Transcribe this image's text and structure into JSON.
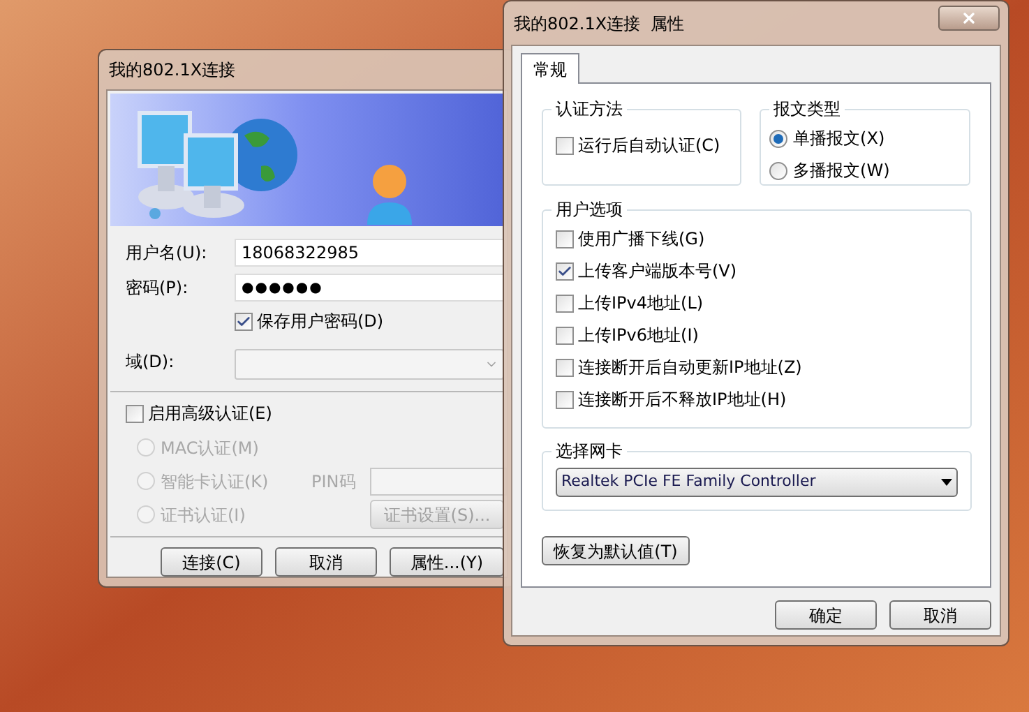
{
  "login_window": {
    "title": "我的802.1X连接",
    "username": {
      "label": "用户名(U):",
      "value": "18068322985"
    },
    "password": {
      "label": "密码(P):",
      "value": "●●●●●●"
    },
    "save_password": {
      "label": "保存用户密码(D)",
      "checked": true
    },
    "domain": {
      "label": "域(D):"
    },
    "advanced_auth": {
      "label": "启用高级认证(E)",
      "checked": false
    },
    "auth_options": [
      {
        "label": "MAC认证(M)",
        "selected": false,
        "disabled": true
      },
      {
        "label": "智能卡认证(K)",
        "selected": false,
        "disabled": true
      },
      {
        "label": "证书认证(I)",
        "selected": false,
        "disabled": true
      }
    ],
    "pin": {
      "label": "PIN码"
    },
    "cert_settings_button": {
      "label": "证书设置(S)...",
      "disabled": true
    },
    "buttons": [
      "连接(C)",
      "取消",
      "属性...(Y)"
    ]
  },
  "properties_window": {
    "title": "我的802.1X连接  属性",
    "tabs": [
      {
        "label": "常规",
        "selected": true
      }
    ],
    "auth_method": {
      "title": "认证方法",
      "option": {
        "label": "运行后自动认证(C)",
        "checked": false
      }
    },
    "packet_type": {
      "title": "报文类型",
      "options": [
        {
          "label": "单播报文(X)",
          "selected": true
        },
        {
          "label": "多播报文(W)",
          "selected": false
        }
      ]
    },
    "user_options": {
      "title": "用户选项",
      "items": [
        {
          "label": "使用广播下线(G)",
          "checked": false
        },
        {
          "label": "上传客户端版本号(V)",
          "checked": true
        },
        {
          "label": "上传IPv4地址(L)",
          "checked": false
        },
        {
          "label": "上传IPv6地址(I)",
          "checked": false
        },
        {
          "label": "连接断开后自动更新IP地址(Z)",
          "checked": false
        },
        {
          "label": "连接断开后不释放IP地址(H)",
          "checked": false
        }
      ]
    },
    "adapter": {
      "title": "选择网卡",
      "value": "Realtek PCIe FE Family Controller"
    },
    "restore_button": "恢复为默认值(T)",
    "buttons": [
      "确定",
      "取消"
    ]
  }
}
